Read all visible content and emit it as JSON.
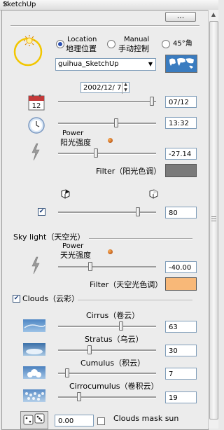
{
  "window": {
    "title": "SketchUp",
    "close_glyph": "✕"
  },
  "toolbar": {
    "more_label": "..."
  },
  "sun": {
    "modes": [
      {
        "label_en": "Location",
        "label_cn": "地理位置",
        "selected": true
      },
      {
        "label_en": "Manual",
        "label_cn": "手动控制",
        "selected": false
      },
      {
        "label_en": "45°角",
        "label_cn": "",
        "selected": false
      }
    ],
    "location_value": "guihua_SketchUp",
    "date_value": "2002/12/  7",
    "date_field": "07/12",
    "time_field": "13:32",
    "power_en": "Power",
    "power_cn": "阳光强度",
    "power_field": "-27.14",
    "filter_label": "Filter（阳光色调）",
    "filter_color": "#7a7a7a",
    "shadow_field": "80"
  },
  "sky": {
    "section_label": "Sky light（天空光）",
    "power_en": "Power",
    "power_cn": "天光强度",
    "power_field": "-40.00",
    "filter_label": "Filter（天空光色调）",
    "filter_color": "#f8b878"
  },
  "clouds": {
    "checkbox_label": "Clouds（云彩）",
    "items": [
      {
        "label": "Cirrus（卷云）",
        "value": "63"
      },
      {
        "label": "Stratus（乌云）",
        "value": "30"
      },
      {
        "label": "Cumulus（积云）",
        "value": "7"
      },
      {
        "label": "Cirrocumulus（卷积云）",
        "value": "19"
      }
    ],
    "bottom_field": "0.00",
    "mask_label": "Clouds mask sun"
  },
  "colors": {
    "accent_radio": "#2a4fb0",
    "slider_dot": "#c0500a"
  }
}
